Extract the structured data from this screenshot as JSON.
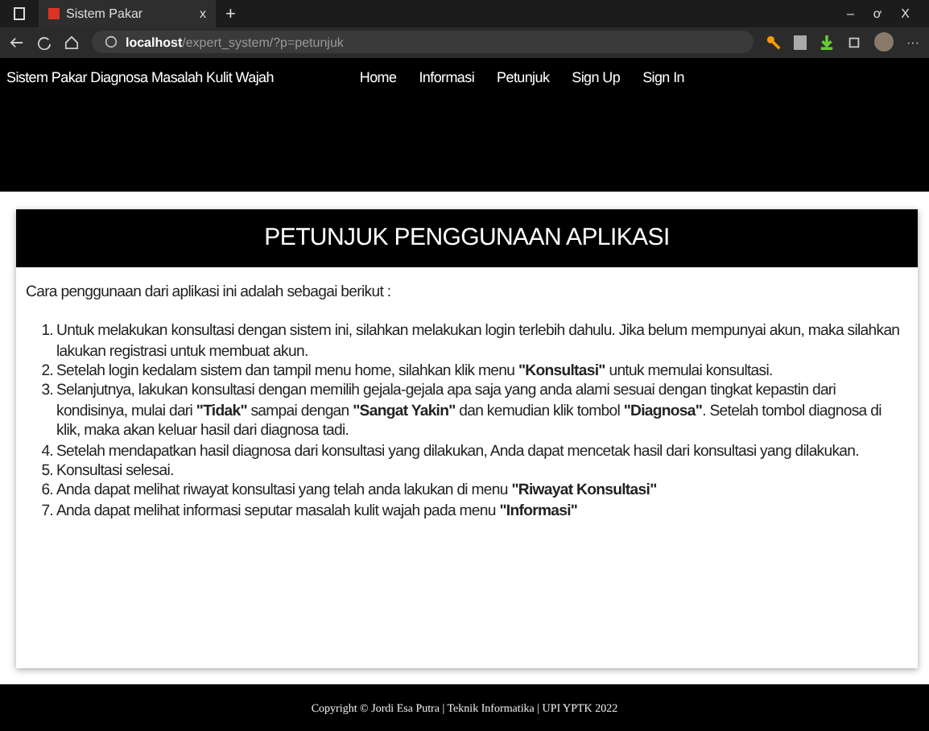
{
  "browser": {
    "tab_title": "Sistem Pakar",
    "tab_symbol": "+",
    "close_symbol": "x",
    "url_host": "localhost",
    "url_path": "/expert_system/?p=petunjuk",
    "window_controls": [
      "–",
      "ơ",
      "X"
    ],
    "more": "···"
  },
  "navbar": {
    "brand": "Sistem Pakar Diagnosa Masalah Kulit Wajah",
    "links": [
      "Home",
      "Informasi",
      "Petunjuk",
      "Sign Up",
      "Sign In"
    ]
  },
  "panel": {
    "title": "PETUNJUK PENGGUNAAN APLIKASI",
    "intro": "Cara penggunaan dari aplikasi ini adalah sebagai berikut :",
    "steps": [
      {
        "number": "1.",
        "text": "Untuk melakukan konsultasi dengan sistem ini, silahkan melakukan login terlebih dahulu. Jika belum mempunyai akun, maka silahkan lakukan registrasi untuk membuat akun."
      },
      {
        "number": "2.",
        "text": "Setelah login kedalam sistem dan tampil menu home, silahkan klik menu **\"Konsultasi\"** untuk memulai konsultasi."
      },
      {
        "number": "3.",
        "text": "Selanjutnya, lakukan konsultasi dengan memilih gejala-gejala apa saja yang anda alami sesuai dengan tingkat kepastin dari kondisinya, mulai dari **\"Tidak\"** sampai dengan **\"Sangat Yakin\"** dan kemudian klik tombol **\"Diagnosa\"**. Setelah tombol diagnosa di klik, maka akan keluar hasil dari diagnosa tadi."
      },
      {
        "number": "4.",
        "text": "Setelah mendapatkan hasil diagnosa dari konsultasi yang dilakukan, Anda dapat mencetak hasil dari konsultasi yang dilakukan."
      },
      {
        "number": "5.",
        "text": "Konsultasi selesai."
      },
      {
        "number": "6.",
        "text": "Anda dapat melihat riwayat konsultasi yang telah anda lakukan di menu **\"Riwayat Konsultasi\"**"
      },
      {
        "number": "7.",
        "text": "Anda dapat melihat informasi seputar masalah kulit wajah pada menu **\"Informasi\"**"
      }
    ]
  },
  "footer": "Copyright © Jordi Esa Putra | Teknik Informatika | UPI YPTK 2022"
}
